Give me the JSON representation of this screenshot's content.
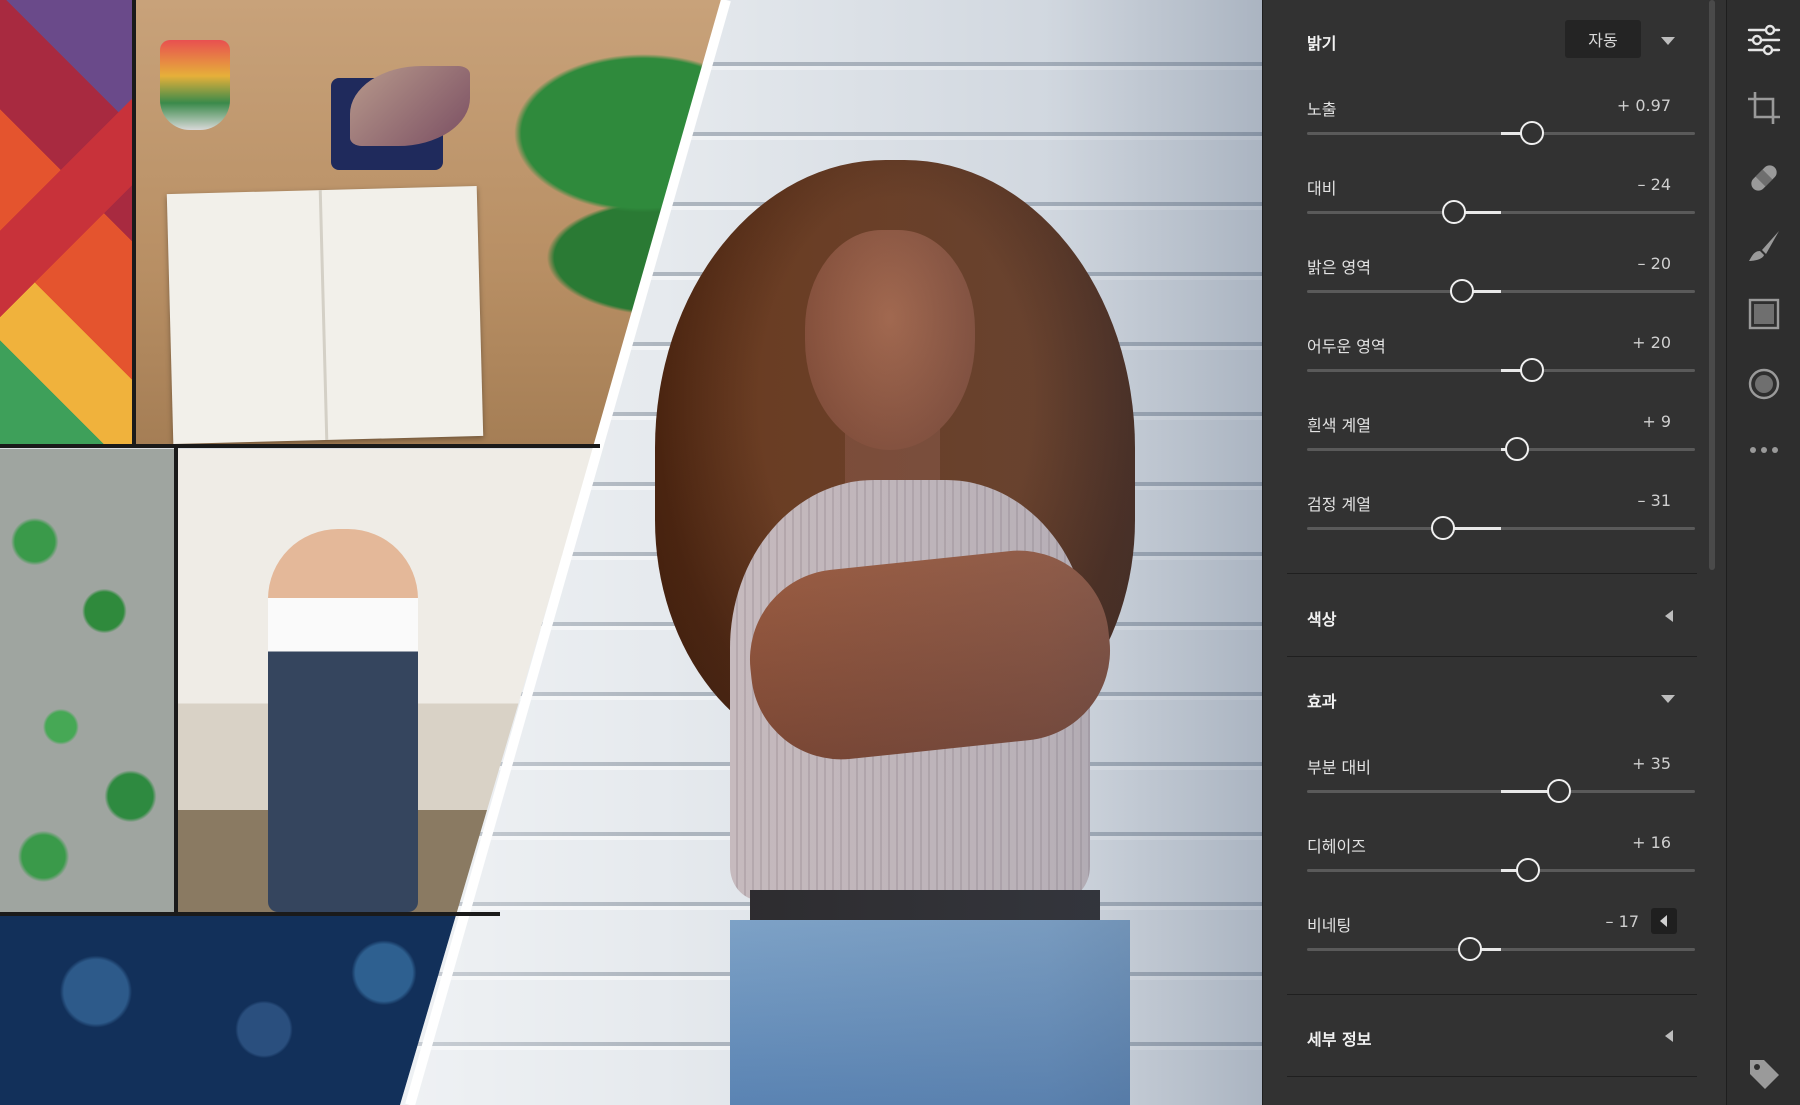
{
  "panel": {
    "light": {
      "title": "밝기",
      "auto_label": "자동",
      "sliders": [
        {
          "label": "노출",
          "value": "+ 0.97",
          "level": 0.58
        },
        {
          "label": "대비",
          "value": "– 24",
          "level": 0.38
        },
        {
          "label": "밝은 영역",
          "value": "– 20",
          "level": 0.4
        },
        {
          "label": "어두운 영역",
          "value": "+ 20",
          "level": 0.58
        },
        {
          "label": "흰색 계열",
          "value": "+ 9",
          "level": 0.54
        },
        {
          "label": "검정 계열",
          "value": "– 31",
          "level": 0.35
        }
      ]
    },
    "color": {
      "title": "색상"
    },
    "effects": {
      "title": "효과",
      "sliders": [
        {
          "label": "부분 대비",
          "value": "+ 35",
          "level": 0.65
        },
        {
          "label": "디헤이즈",
          "value": "+ 16",
          "level": 0.57
        },
        {
          "label": "비네팅",
          "value": "– 17",
          "level": 0.42
        }
      ]
    },
    "detail": {
      "title": "세부 정보"
    }
  },
  "tools": [
    {
      "name": "edit-sliders-icon"
    },
    {
      "name": "crop-rotate-icon"
    },
    {
      "name": "healing-bandage-icon"
    },
    {
      "name": "brush-icon"
    },
    {
      "name": "linear-gradient-icon"
    },
    {
      "name": "radial-gradient-icon"
    },
    {
      "name": "more-options-icon"
    },
    {
      "name": "tag-icon"
    }
  ],
  "colors": {
    "panel_bg": "#323232",
    "tool_strip_bg": "#2e2e2e",
    "text": "#e6e6e6",
    "slider_fill": "#e8e8e8",
    "slider_track": "#5a5a5a"
  }
}
